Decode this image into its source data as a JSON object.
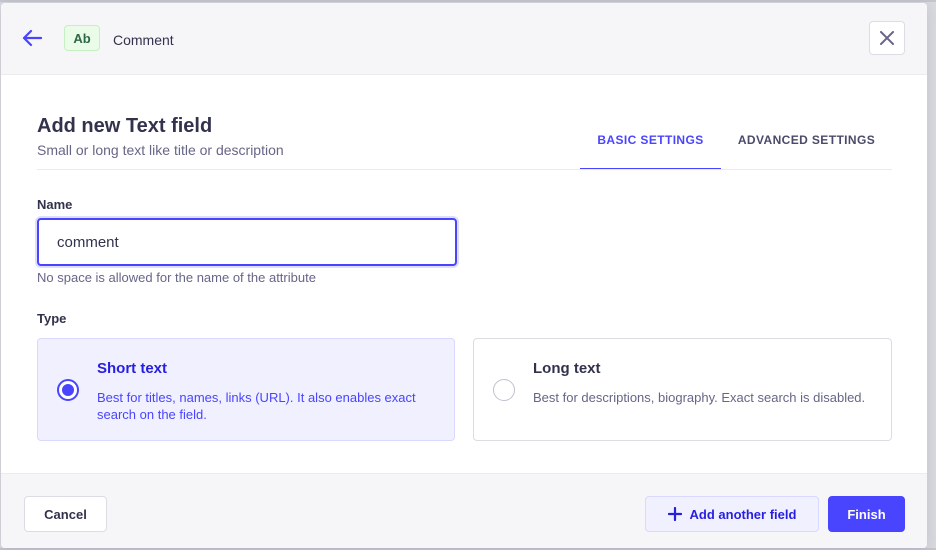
{
  "header": {
    "badge": "Ab",
    "title": "Comment"
  },
  "form": {
    "title": "Add new Text field",
    "subtitle": "Small or long text like title or description",
    "tabs": [
      {
        "label": "BASIC SETTINGS",
        "active": true
      },
      {
        "label": "ADVANCED SETTINGS",
        "active": false
      }
    ],
    "name": {
      "label": "Name",
      "value": "comment",
      "hint": "No space is allowed for the name of the attribute"
    },
    "type": {
      "label": "Type",
      "options": [
        {
          "title": "Short text",
          "description": "Best for titles, names, links (URL). It also enables exact search on the field.",
          "selected": true
        },
        {
          "title": "Long text",
          "description": "Best for descriptions, biography. Exact search is disabled.",
          "selected": false
        }
      ]
    }
  },
  "footer": {
    "cancel_label": "Cancel",
    "add_label": "Add another field",
    "finish_label": "Finish"
  },
  "colors": {
    "primary": "#4945ff",
    "badge_bg": "#eafbe7",
    "badge_text": "#2f6846"
  },
  "icons": {
    "back": "arrow-left-icon",
    "close": "close-icon",
    "add": "plus-icon"
  }
}
